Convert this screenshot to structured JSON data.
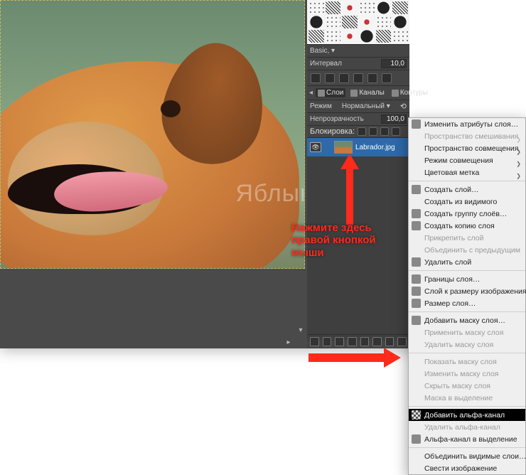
{
  "watermark": "Яблык",
  "brush_preset_name": "Basic,",
  "interval_label": "Интервал",
  "interval_value": "10,0",
  "tabs": {
    "layers": "Слои",
    "channels": "Каналы",
    "paths": "Контуры"
  },
  "mode_label": "Режим",
  "mode_value": "Нормальный",
  "opacity_label": "Непрозрачность",
  "opacity_value": "100,0",
  "lock_label": "Блокировка:",
  "layer_name": "Labrador.jpg",
  "callout_line1": "Нажмите здесь",
  "callout_line2": "правой кнопкой",
  "callout_line3": "мыши",
  "ctx": {
    "edit_attrs": "Изменить атрибуты слоя…",
    "blend_space": "Пространство смешивания",
    "composite_space": "Пространство совмещения",
    "composite_mode": "Режим совмещения",
    "color_tag": "Цветовая метка",
    "new_layer": "Создать слой…",
    "new_from_visible": "Создать из видимого",
    "new_group": "Создать группу слоёв…",
    "duplicate": "Создать копию слоя",
    "anchor": "Прикрепить слой",
    "merge_down": "Объединить с предыдущим",
    "delete": "Удалить слой",
    "boundary": "Границы слоя…",
    "to_image_size": "Слой к размеру изображения",
    "scale": "Размер слоя…",
    "add_mask": "Добавить маску слоя…",
    "apply_mask": "Применить маску слоя",
    "delete_mask": "Удалить маску слоя",
    "show_mask": "Показать маску слоя",
    "edit_mask": "Изменить маску слоя",
    "hide_mask": "Скрыть маску слоя",
    "mask_to_sel": "Маска в выделение",
    "add_alpha": "Добавить альфа-канал",
    "remove_alpha": "Удалить альфа-канал",
    "alpha_to_sel": "Альфа-канал в выделение",
    "merge_visible": "Объединить видимые слои…",
    "flatten": "Свести изображение"
  }
}
